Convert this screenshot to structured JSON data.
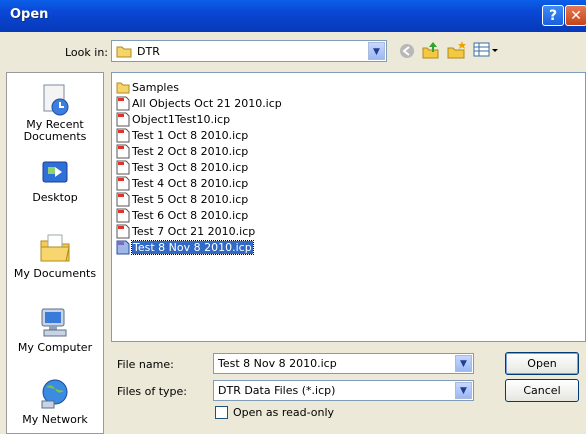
{
  "window": {
    "title": "Open"
  },
  "lookin": {
    "label": "Look in:",
    "value": "DTR"
  },
  "places": [
    {
      "label": "My Recent\nDocuments",
      "icon": "recent-documents-icon"
    },
    {
      "label": "Desktop",
      "icon": "desktop-icon"
    },
    {
      "label": "My Documents",
      "icon": "my-documents-icon"
    },
    {
      "label": "My Computer",
      "icon": "my-computer-icon"
    },
    {
      "label": "My Network",
      "icon": "my-network-icon"
    }
  ],
  "files": [
    {
      "name": "Samples",
      "type": "folder"
    },
    {
      "name": "All Objects Oct 21 2010.icp",
      "type": "file"
    },
    {
      "name": "Object1Test10.icp",
      "type": "file"
    },
    {
      "name": "Test 1 Oct 8 2010.icp",
      "type": "file"
    },
    {
      "name": "Test 2 Oct 8 2010.icp",
      "type": "file"
    },
    {
      "name": "Test 3 Oct 8 2010.icp",
      "type": "file"
    },
    {
      "name": "Test 4 Oct 8 2010.icp",
      "type": "file"
    },
    {
      "name": "Test 5 Oct 8 2010.icp",
      "type": "file"
    },
    {
      "name": "Test 6 Oct 8 2010.icp",
      "type": "file"
    },
    {
      "name": "Test 7 Oct 21 2010.icp",
      "type": "file"
    },
    {
      "name": "Test 8 Nov 8 2010.icp",
      "type": "file",
      "selected": true
    }
  ],
  "filename": {
    "label": "File name:",
    "value": "Test 8 Nov 8 2010.icp"
  },
  "filetype": {
    "label": "Files of type:",
    "value": "DTR Data Files (*.icp)"
  },
  "readonly": {
    "label": "Open as read-only"
  },
  "buttons": {
    "open": "Open",
    "cancel": "Cancel"
  },
  "colors": {
    "titlebar": "#0a48d6",
    "selection": "#316ac5",
    "dialog": "#ece9d8"
  }
}
